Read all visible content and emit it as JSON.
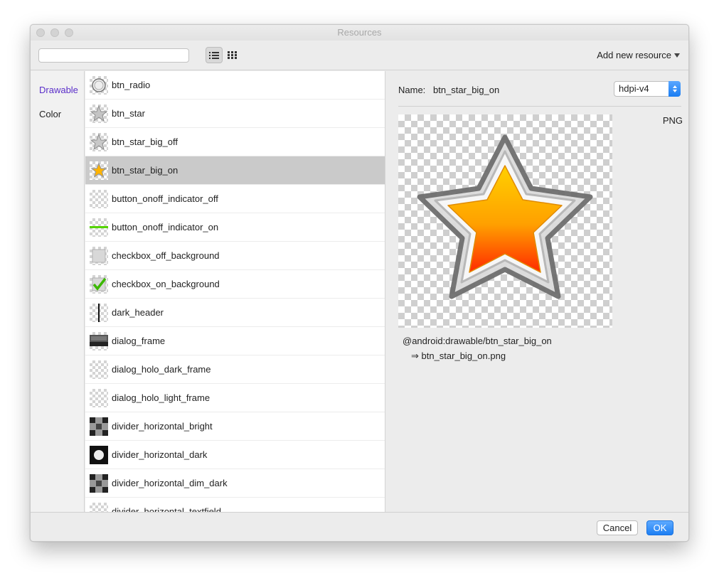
{
  "window": {
    "title": "Resources"
  },
  "toolbar": {
    "search_value": "",
    "add_resource_label": "Add new resource"
  },
  "nav": {
    "items": [
      {
        "label": "Drawable",
        "selected": true
      },
      {
        "label": "Color",
        "selected": false
      }
    ]
  },
  "list": {
    "items": [
      {
        "label": "btn_radio",
        "icon": "radio-thumb-icon"
      },
      {
        "label": "btn_star",
        "icon": "star-gray-thumb-icon"
      },
      {
        "label": "btn_star_big_off",
        "icon": "star-gray-thumb-icon"
      },
      {
        "label": "btn_star_big_on",
        "icon": "star-gold-thumb-icon",
        "selected": true
      },
      {
        "label": "button_onoff_indicator_off",
        "icon": "transparent-thumb-icon"
      },
      {
        "label": "button_onoff_indicator_on",
        "icon": "green-line-thumb-icon"
      },
      {
        "label": "checkbox_off_background",
        "icon": "checkbox-off-thumb-icon"
      },
      {
        "label": "checkbox_on_background",
        "icon": "checkmark-thumb-icon"
      },
      {
        "label": "dark_header",
        "icon": "dark-header-thumb-icon"
      },
      {
        "label": "dialog_frame",
        "icon": "dialog-frame-thumb-icon"
      },
      {
        "label": "dialog_holo_dark_frame",
        "icon": "transparent-thumb-icon"
      },
      {
        "label": "dialog_holo_light_frame",
        "icon": "transparent-thumb-icon"
      },
      {
        "label": "divider_horizontal_bright",
        "icon": "divider-thumb-icon"
      },
      {
        "label": "divider_horizontal_dark",
        "icon": "divider-dark-thumb-icon"
      },
      {
        "label": "divider_horizontal_dim_dark",
        "icon": "divider-thumb-icon"
      },
      {
        "label": "divider_horizontal_textfield",
        "icon": "transparent-thumb-icon"
      }
    ]
  },
  "detail": {
    "name_label": "Name:",
    "name_value": "btn_star_big_on",
    "density": "hdpi-v4",
    "format": "PNG",
    "reference": "@android:drawable/btn_star_big_on",
    "file": "⇒ btn_star_big_on.png"
  },
  "footer": {
    "cancel_label": "Cancel",
    "ok_label": "OK"
  },
  "colors": {
    "accent": "#1d7ff3",
    "nav_selected": "#5a2ec9",
    "selection": "#cacaca"
  }
}
